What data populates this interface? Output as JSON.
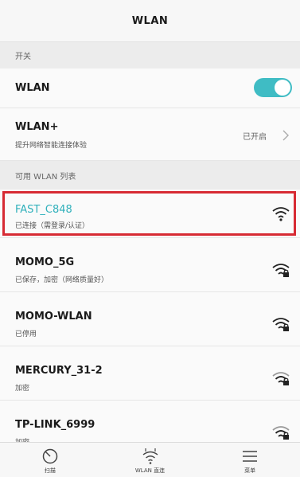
{
  "header": {
    "title": "WLAN"
  },
  "switch_section": {
    "label": "开关"
  },
  "wlan_switch": {
    "label": "WLAN",
    "on": true
  },
  "wlan_plus": {
    "label": "WLAN+",
    "description": "提升网络智能连接体验",
    "status": "已开启"
  },
  "list_section": {
    "label": "可用 WLAN 列表"
  },
  "networks": [
    {
      "ssid": "FAST_C848",
      "status": "已连接（需登录/认证）",
      "selected": true,
      "locked": false,
      "color": "#2fb0bb"
    },
    {
      "ssid": "MOMO_5G",
      "status": "已保存，加密（网络质量好）",
      "selected": false,
      "locked": true,
      "color": "#1a1a1a"
    },
    {
      "ssid": "MOMO-WLAN",
      "status": "已停用",
      "selected": false,
      "locked": true,
      "color": "#1a1a1a"
    },
    {
      "ssid": "MERCURY_31-2",
      "status": "加密",
      "selected": false,
      "locked": true,
      "color": "#1a1a1a"
    },
    {
      "ssid": "TP-LINK_6999",
      "status": "加密",
      "selected": false,
      "locked": true,
      "color": "#1a1a1a"
    }
  ],
  "bottom_tabs": [
    {
      "label": "扫描",
      "icon": "scan-icon"
    },
    {
      "label": "WLAN 直连",
      "icon": "wlan-direct-icon"
    },
    {
      "label": "菜单",
      "icon": "menu-icon"
    }
  ],
  "colors": {
    "accent": "#3fbcc4",
    "highlight_border": "#d72a33"
  }
}
